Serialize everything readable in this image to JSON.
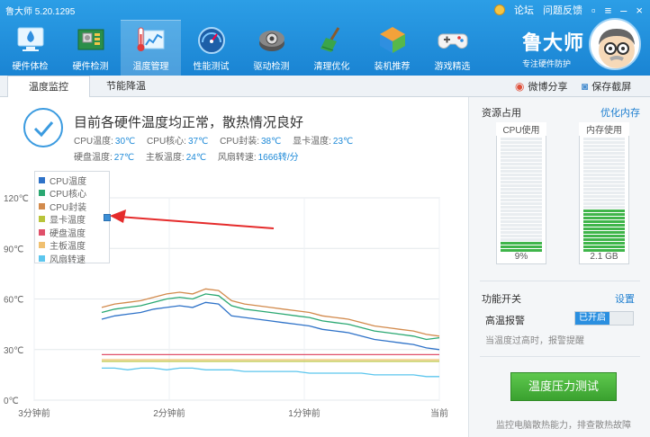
{
  "app": {
    "title": "鲁大师 5.20.1295",
    "brand_name": "鲁大师",
    "brand_sub": "专注硬件防护",
    "links": [
      "论坛",
      "问题反馈"
    ]
  },
  "nav": [
    {
      "label": "硬件体检",
      "icon": "monitor-check-icon"
    },
    {
      "label": "硬件检测",
      "icon": "circuit-board-icon"
    },
    {
      "label": "温度管理",
      "icon": "thermometer-icon"
    },
    {
      "label": "性能测试",
      "icon": "speedometer-icon"
    },
    {
      "label": "驱动检测",
      "icon": "driver-gear-icon"
    },
    {
      "label": "清理优化",
      "icon": "broom-icon"
    },
    {
      "label": "装机推荐",
      "icon": "cube-icon"
    },
    {
      "label": "游戏精选",
      "icon": "gamepad-icon"
    }
  ],
  "tabs": {
    "temp_monitor": "温度监控",
    "power_saving": "节能降温",
    "weibo_share": "微博分享",
    "save_screenshot": "保存截屏"
  },
  "status": {
    "message": "目前各硬件温度均正常，散热情况良好",
    "row1": [
      {
        "label": "CPU温度:",
        "value": "30℃"
      },
      {
        "label": "CPU核心:",
        "value": "37℃"
      },
      {
        "label": "CPU封装:",
        "value": "38℃"
      },
      {
        "label": "显卡温度:",
        "value": "23℃"
      }
    ],
    "row2": [
      {
        "label": "硬盘温度:",
        "value": "27℃"
      },
      {
        "label": "主板温度:",
        "value": "24℃"
      },
      {
        "label": "风扇转速:",
        "value": "1666转/分"
      }
    ]
  },
  "chart_data": {
    "type": "line",
    "y_ticks": [
      "120℃",
      "90℃",
      "60℃",
      "30℃",
      "0℃"
    ],
    "y_tick_values": [
      120,
      90,
      60,
      30,
      0
    ],
    "x_ticks": [
      "3分钟前",
      "2分钟前",
      "1分钟前",
      "当前"
    ],
    "x_tick_values": [
      180,
      120,
      60,
      0
    ],
    "ylim": [
      0,
      120
    ],
    "xlim": [
      180,
      0
    ],
    "grid": true,
    "legend_placement": "top-left",
    "series": [
      {
        "name": "CPU温度",
        "color": "#2e72c8",
        "values": [
          48,
          50,
          51,
          52,
          54,
          55,
          56,
          55,
          58,
          57,
          50,
          49,
          48,
          47,
          46,
          45,
          44,
          42,
          41,
          40,
          38,
          36,
          35,
          34,
          33,
          31,
          30
        ]
      },
      {
        "name": "CPU核心",
        "color": "#2aa872",
        "values": [
          52,
          54,
          55,
          56,
          58,
          60,
          61,
          60,
          63,
          62,
          56,
          54,
          53,
          52,
          51,
          50,
          49,
          47,
          46,
          45,
          43,
          41,
          40,
          39,
          38,
          36,
          37
        ]
      },
      {
        "name": "CPU封装",
        "color": "#d28a4c",
        "values": [
          55,
          57,
          58,
          59,
          61,
          63,
          64,
          63,
          66,
          65,
          59,
          57,
          56,
          55,
          54,
          53,
          52,
          50,
          49,
          48,
          46,
          44,
          43,
          42,
          41,
          39,
          38
        ]
      },
      {
        "name": "显卡温度",
        "color": "#b8c43a",
        "values": [
          23,
          23,
          23,
          23,
          23,
          23,
          23,
          23,
          23,
          23,
          23,
          23,
          23,
          23,
          23,
          23,
          23,
          23,
          23,
          23,
          23,
          23,
          23,
          23,
          23,
          23,
          23
        ]
      },
      {
        "name": "硬盘温度",
        "color": "#e0506a",
        "values": [
          27,
          27,
          27,
          27,
          27,
          27,
          27,
          27,
          27,
          27,
          27,
          27,
          27,
          27,
          27,
          27,
          27,
          27,
          27,
          27,
          27,
          27,
          27,
          27,
          27,
          27,
          27
        ]
      },
      {
        "name": "主板温度",
        "color": "#f0c070",
        "values": [
          24,
          24,
          24,
          24,
          24,
          24,
          24,
          24,
          24,
          24,
          24,
          24,
          24,
          24,
          24,
          24,
          24,
          24,
          24,
          24,
          24,
          24,
          24,
          24,
          24,
          24,
          24
        ]
      },
      {
        "name": "风扇转速",
        "color": "#5cc6ee",
        "values": [
          19,
          19,
          18,
          19,
          19,
          18,
          19,
          19,
          18,
          18,
          18,
          17,
          17,
          17,
          17,
          17,
          16,
          16,
          16,
          16,
          16,
          15,
          15,
          15,
          15,
          14,
          14
        ]
      }
    ]
  },
  "side": {
    "resource_title": "资源占用",
    "optimize_link": "优化内存",
    "cpu_label": "CPU使用",
    "cpu_value": "9%",
    "cpu_fraction": 0.09,
    "mem_label": "内存使用",
    "mem_value": "2.1 GB",
    "mem_fraction": 0.36,
    "switch_title": "功能开关",
    "settings_link": "设置",
    "alarm_label": "高温报警",
    "alarm_state": "已开启",
    "alarm_note": "当温度过高时，报警提醒",
    "stress_button": "温度压力测试",
    "bottom_note": "监控电脑散热能力，排查散热故障",
    "colors": {
      "gauge_fill": "#3fb54a",
      "accent": "#1e8ad8"
    }
  }
}
